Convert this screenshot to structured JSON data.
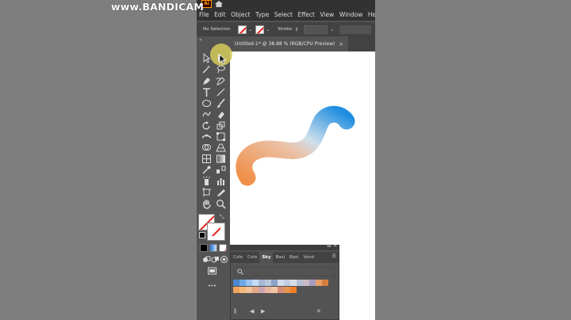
{
  "watermark": {
    "text": "www.BANDICAM"
  },
  "app": {
    "logo_text": "Ai"
  },
  "menu": [
    "File",
    "Edit",
    "Object",
    "Type",
    "Select",
    "Effect",
    "View",
    "Window",
    "Help"
  ],
  "control_bar": {
    "selection_status": "No Selection",
    "stroke_label": "Stroke:"
  },
  "document": {
    "tab_title": "Untitled-1* @ 38.88 % (RGB/CPU Preview)",
    "close_glyph": "×"
  },
  "colors": {
    "stroke_start": "#f0904a",
    "stroke_mid": "#e9cdb8",
    "stroke_end": "#1f8de0",
    "highlight": "#d6cd5a"
  },
  "icons": {
    "tools": [
      "selection-tool",
      "direct-selection-tool",
      "magic-wand-tool",
      "lasso-tool",
      "pen-tool",
      "curvature-tool",
      "type-tool",
      "line-segment-tool",
      "ellipse-tool",
      "paintbrush-tool",
      "shaper-tool",
      "eraser-tool",
      "rotate-tool",
      "scale-tool",
      "width-tool",
      "free-transform-tool",
      "shape-builder-tool",
      "perspective-grid-tool",
      "mesh-tool",
      "gradient-tool",
      "eyedropper-tool",
      "blend-tool",
      "symbol-sprayer-tool",
      "column-graph-tool",
      "artboard-tool",
      "slice-tool",
      "hand-tool",
      "zoom-tool"
    ]
  },
  "swatch_panel": {
    "tabs": [
      "Colo",
      "Colo",
      "Sky",
      "Basi",
      "Basi",
      "Vond"
    ],
    "active_tab": "Sky",
    "row1": [
      "#4a87d0",
      "#6ea8e6",
      "#9cc4ee",
      "#c3daf2",
      "#a7b7d4",
      "#b9c7dc",
      "#8ea3c9",
      "#d5dcea",
      "#c4cde0",
      "#d9dfe9",
      "#b4bfd6",
      "#c9b8c6",
      "#a79cc0",
      "#e7a06a",
      "#d67f3c"
    ],
    "row2": [
      "#f0a45a",
      "#f6b77a",
      "#f2c19a",
      "#e6a888",
      "#c9a4b0",
      "#e9b7a0",
      "#f2c7a8",
      "#d58c74",
      "#e7944f",
      "#f07e2a"
    ]
  }
}
